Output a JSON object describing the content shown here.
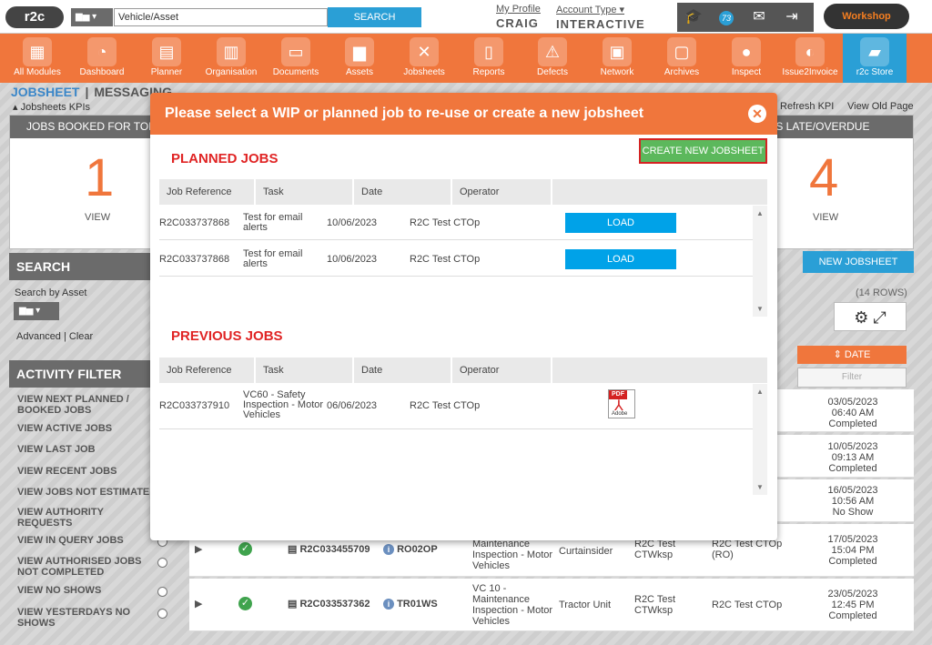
{
  "topbar": {
    "logo": "r2c",
    "vehicle_type_icon": "truck-icon",
    "search_placeholder": "Vehicle/Asset",
    "search_button": "SEARCH",
    "profile_link": "My Profile",
    "profile_name": "CRAIG",
    "account_link": "Account Type",
    "account_value": "INTERACTIVE",
    "notification_count": "73",
    "workshop_label": "Workshop"
  },
  "nav": [
    {
      "label": "All Modules",
      "icon": "grid-icon"
    },
    {
      "label": "Dashboard",
      "icon": "speedometer-icon"
    },
    {
      "label": "Planner",
      "icon": "calendar-icon"
    },
    {
      "label": "Organisation",
      "icon": "building-icon"
    },
    {
      "label": "Documents",
      "icon": "folder-icon"
    },
    {
      "label": "Assets",
      "icon": "truck-icon"
    },
    {
      "label": "Jobsheets",
      "icon": "tools-icon"
    },
    {
      "label": "Reports",
      "icon": "clipboard-icon"
    },
    {
      "label": "Defects",
      "icon": "warning-icon"
    },
    {
      "label": "Network",
      "icon": "contact-icon"
    },
    {
      "label": "Archives",
      "icon": "archive-icon"
    },
    {
      "label": "Inspect",
      "icon": "inspect-icon"
    },
    {
      "label": "Issue2Invoice",
      "icon": "invoice-icon"
    },
    {
      "label": "r2c Store",
      "icon": "briefcase-icon"
    }
  ],
  "page": {
    "title": "JOBSHEET",
    "messaging": "MESSAGING",
    "kpis_link": "Jobsheets KPIs",
    "refresh_kpi": "Refresh KPI",
    "view_old_page": "View Old Page"
  },
  "kpi_tiles": [
    {
      "header": "JOBS BOOKED FOR TODAY",
      "value": "1",
      "view": "VIEW"
    },
    {
      "header": "JOBS LATE/OVERDUE",
      "value": "4",
      "view": "VIEW"
    }
  ],
  "search_panel": {
    "header": "SEARCH",
    "search_by_asset": "Search by Asset",
    "advanced": "Advanced",
    "clear": "Clear"
  },
  "activity_filter": {
    "header": "ACTIVITY FILTER",
    "items": [
      "VIEW NEXT PLANNED / BOOKED JOBS",
      "VIEW ACTIVE JOBS",
      "VIEW LAST JOB",
      "VIEW RECENT JOBS",
      "VIEW JOBS NOT ESTIMATED",
      "VIEW AUTHORITY REQUESTS",
      "VIEW IN QUERY JOBS",
      "VIEW AUTHORISED JOBS NOT COMPLETED",
      "VIEW NO SHOWS",
      "VIEW YESTERDAYS NO SHOWS"
    ]
  },
  "background_table": {
    "new_jobsheet": "NEW JOBSHEET",
    "rows_count": "(14 ROWS)",
    "date_header": "DATE",
    "filter_placeholder": "Filter",
    "dates": [
      {
        "date": "03/05/2023",
        "time": "06:40 AM",
        "status": "Completed"
      },
      {
        "date": "10/05/2023",
        "time": "09:13 AM",
        "status": "Completed"
      },
      {
        "date": "16/05/2023",
        "time": "10:56 AM",
        "status": "No Show"
      }
    ],
    "rows": [
      {
        "job": "R2C033455709",
        "reg": "RO02OP",
        "task": "Maintenance Inspection - Motor Vehicles",
        "type": "Curtainsider",
        "site": "R2C Test CTWksp",
        "operator": "R2C Test CTOp (RO)",
        "date": "17/05/2023",
        "time": "15:04 PM",
        "status": "Completed"
      },
      {
        "job": "R2C033537362",
        "reg": "TR01WS",
        "task": "VC 10 - Maintenance Inspection - Motor Vehicles",
        "type": "Tractor Unit",
        "site": "R2C Test CTWksp",
        "operator": "R2C Test CTOp",
        "date": "23/05/2023",
        "time": "12:45 PM",
        "status": "Completed"
      }
    ]
  },
  "modal": {
    "title": "Please select a WIP or planned job to re-use or create a new jobsheet",
    "create_button": "CREATE NEW JOBSHEET",
    "planned_title": "PLANNED JOBS",
    "previous_title": "PREVIOUS JOBS",
    "columns": [
      "Job Reference",
      "Task",
      "Date",
      "Operator"
    ],
    "planned_jobs": [
      {
        "ref": "R2C033737868",
        "task": "Test for email alerts",
        "date": "10/06/2023",
        "operator": "R2C Test CTOp",
        "action": "LOAD"
      },
      {
        "ref": "R2C033737868",
        "task": "Test for email alerts",
        "date": "10/06/2023",
        "operator": "R2C Test CTOp",
        "action": "LOAD"
      }
    ],
    "previous_jobs": [
      {
        "ref": "R2C033737910",
        "task": "VC60 - Safety Inspection - Motor Vehicles",
        "date": "06/06/2023",
        "operator": "R2C Test CTOp",
        "pdf_label": "PDF",
        "pdf_brand": "Adobe"
      }
    ]
  }
}
